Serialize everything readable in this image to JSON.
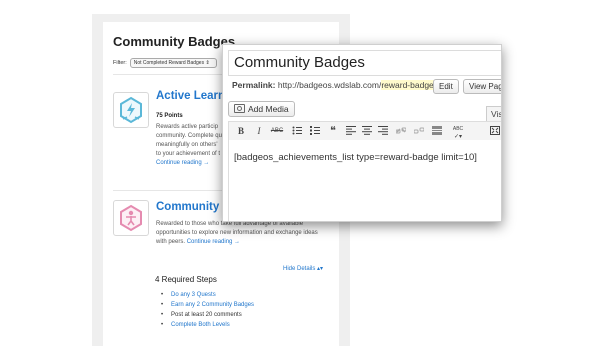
{
  "page": {
    "title": "Community Badges",
    "filter_label": "Filter:",
    "filter_value": "Not Completed Reward Badges"
  },
  "badges": [
    {
      "title": "Active Learne",
      "points": "75 Points",
      "desc": [
        "Rewards active particip",
        "community. Complete qu",
        "meaningfully on others'",
        "to your achievement of t"
      ],
      "continue": "Continue reading →",
      "icon": "lightning-badge-icon",
      "color": "#5bb8d8"
    },
    {
      "title": "Community Ac",
      "desc": [
        "Rewarded to those who take full advantage of available",
        "opportunities to explore new information and exchange ideas"
      ],
      "desc_last": "with peers.",
      "continue": "Continue reading →",
      "icon": "person-badge-icon",
      "color": "#e58bb0"
    }
  ],
  "details": {
    "hide_label": "Hide Details",
    "required_title": "4 Required Steps",
    "steps": [
      {
        "text": "Do any 3 Quests",
        "link": true
      },
      {
        "text": "Earn any 2 Community Badges",
        "link": true
      },
      {
        "text": "Post at least 20 comments",
        "link": false
      },
      {
        "text": "Complete Both Levels",
        "link": true
      }
    ]
  },
  "editor": {
    "post_title": "Community Badges",
    "permalink_label": "Permalink:",
    "permalink_base": "http://badgeos.wdslab.com/",
    "permalink_slug": "reward-badges",
    "permalink_end": "/",
    "edit_button": "Edit",
    "view_button": "View Pag",
    "add_media": "Add Media",
    "visual_tab": "Vis",
    "content": "[badgeos_achievements_list type=reward-badge limit=10]",
    "toolbar": {
      "bold": "B",
      "italic": "I",
      "strike": "ABC",
      "quote": "❝",
      "spell": "ABC"
    }
  }
}
